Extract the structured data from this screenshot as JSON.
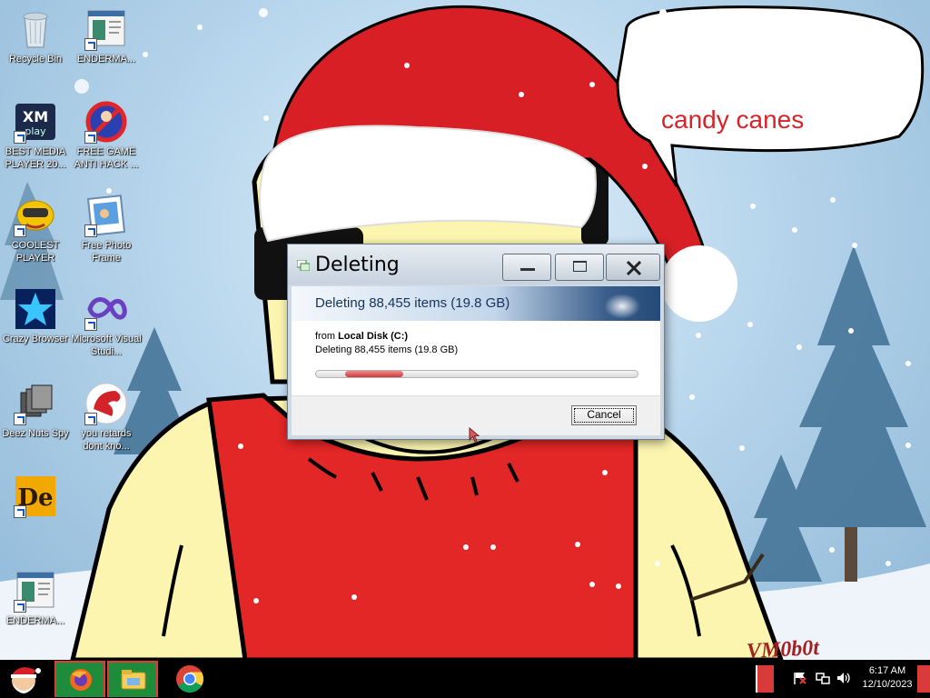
{
  "desktop": {
    "icons": [
      {
        "label": "Recycle Bin",
        "icon": "recycle-bin-icon"
      },
      {
        "label": "ENDERMA...",
        "icon": "app-window-icon"
      },
      {
        "label": "BEST MEDIA PLAYER 20...",
        "icon": "xmplay-icon"
      },
      {
        "label": "FREE GAME ANTI HACK ...",
        "icon": "anti-hack-icon"
      },
      {
        "label": "COOLEST PLAYER",
        "icon": "media-player-icon"
      },
      {
        "label": "Free Photo Frame",
        "icon": "photo-frame-icon"
      },
      {
        "label": "Crazy Browser",
        "icon": "star-browser-icon"
      },
      {
        "label": "Microsoft Visual Studi...",
        "icon": "visual-studio-icon"
      },
      {
        "label": "Deez Nuts Spy",
        "icon": "spy-icon"
      },
      {
        "label": "you retards dont kno...",
        "icon": "red-dragon-icon"
      },
      {
        "label": "",
        "icon": "de-app-icon"
      },
      {
        "label": "ENDERMA...",
        "icon": "app-window-icon"
      }
    ]
  },
  "wallpaper": {
    "bubble_line1": "",
    "bubble_line2": "",
    "bubble_line3": "candy canes",
    "signature": "VM0b0t"
  },
  "dialog": {
    "title": "Deleting",
    "heading": "Deleting 88,455 items (19.8 GB)",
    "from_prefix": "from",
    "from_location": "Local Disk (C:)",
    "detail": "Deleting 88,455 items (19.8 GB)",
    "progress": {
      "indeterminate": true,
      "marquee_start": 0.09,
      "marquee_end": 0.27
    },
    "cancel_label": "Cancel",
    "buttons": {
      "minimize": "minimize-icon",
      "maximize": "maximize-icon",
      "close": "close-icon"
    }
  },
  "taskbar": {
    "pinned": [
      "firefox-icon",
      "file-explorer-icon",
      "chrome-icon"
    ],
    "time": "6:17 AM",
    "date": "12/10/2023",
    "tray_icons": [
      "warning-flag-icon",
      "network-icon",
      "volume-icon"
    ]
  },
  "colors": {
    "taskbar_bg": "#000000",
    "taskbar_item_bg": "#1e8c3a",
    "taskbar_item_border": "#e23a3a",
    "progress_fill": "#c93b3b",
    "banner_text": "#14335a"
  }
}
